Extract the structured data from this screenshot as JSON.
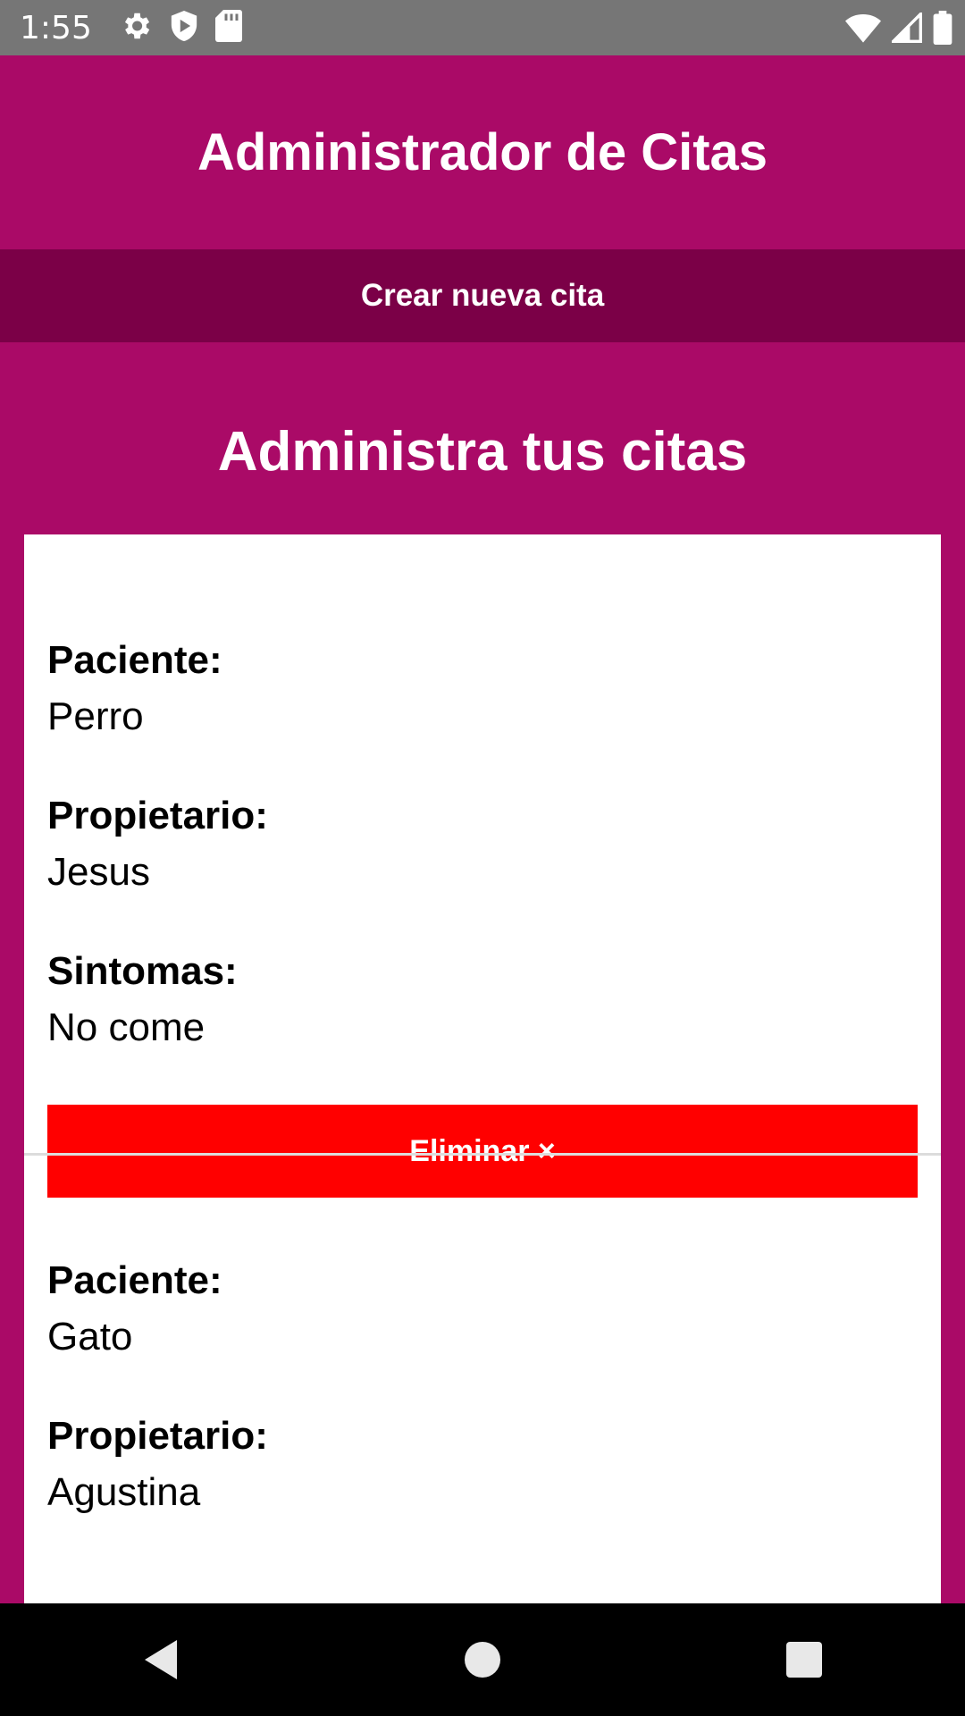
{
  "status_bar": {
    "time": "1:55",
    "left_icons": [
      "settings-icon",
      "shield-icon",
      "sd-card-icon"
    ],
    "right_icons": [
      "wifi-icon",
      "signal-icon",
      "battery-icon"
    ]
  },
  "header": {
    "title": "Administrador de Citas"
  },
  "new_appointment_button": {
    "label": "Crear nueva cita"
  },
  "section": {
    "title": "Administra tus citas"
  },
  "appointments": [
    {
      "patient_label": "Paciente:",
      "patient": "Perro",
      "owner_label": "Propietario:",
      "owner": "Jesus",
      "symptoms_label": "Sintomas:",
      "symptoms": "No come",
      "delete_label": "Eliminar ×"
    },
    {
      "patient_label": "Paciente:",
      "patient": "Gato",
      "owner_label": "Propietario:",
      "owner": "Agustina"
    }
  ],
  "colors": {
    "primary": "#aa0a67",
    "primary_dark": "#7b0047",
    "danger": "#ff0000"
  },
  "nav_bar": {
    "icons": [
      "back-icon",
      "home-icon",
      "recents-icon"
    ]
  }
}
